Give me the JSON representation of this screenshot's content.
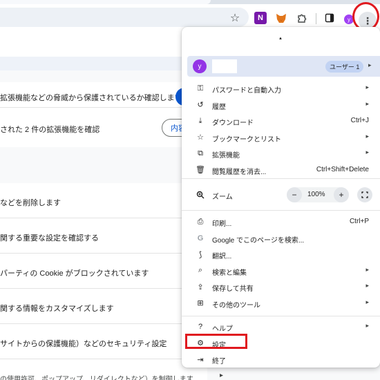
{
  "toolbar": {
    "onenote_label": "N",
    "avatar_letter": "y",
    "kebab_label": "⋮"
  },
  "page": {
    "card1_text1": "拡張機能などの脅威から保護されているか確認します",
    "card1_text2": "された 2 件の拡張機能を確認",
    "review_button": "内容",
    "rows": [
      "などを削除します",
      "関する重要な設定を確認する",
      "パーティの Cookie がブロックされています",
      "関する情報をカスタマイズします",
      "サイトからの保護機能）などのセキュリティ設定"
    ],
    "bottom_text": "の使用許可、ポップアップ、リダイレクトなど）を制御します"
  },
  "menu": {
    "profile": {
      "avatar_letter": "y",
      "badge": "ユーザー 1"
    },
    "items_group1": [
      {
        "icon": "key-icon",
        "glyph": "⚿",
        "label": "パスワードと自動入力",
        "shortcut": "",
        "submenu": true
      },
      {
        "icon": "history-icon",
        "glyph": "↺",
        "label": "履歴",
        "shortcut": "",
        "submenu": true
      },
      {
        "icon": "download-icon",
        "glyph": "⤓",
        "label": "ダウンロード",
        "shortcut": "Ctrl+J",
        "submenu": false
      },
      {
        "icon": "star-icon",
        "glyph": "☆",
        "label": "ブックマークとリスト",
        "shortcut": "",
        "submenu": true
      },
      {
        "icon": "puzzle-icon",
        "glyph": "⧉",
        "label": "拡張機能",
        "shortcut": "",
        "submenu": true
      },
      {
        "icon": "trash-icon",
        "glyph": "🗑",
        "label": "閲覧履歴を消去...",
        "shortcut": "Ctrl+Shift+Delete",
        "submenu": false
      }
    ],
    "zoom": {
      "label": "ズーム",
      "minus": "−",
      "value": "100%",
      "plus": "+"
    },
    "items_group2": [
      {
        "icon": "print-icon",
        "glyph": "⎙",
        "label": "印刷...",
        "shortcut": "Ctrl+P",
        "submenu": false
      },
      {
        "icon": "google-icon",
        "glyph": "G",
        "label": "Google でこのページを検索...",
        "shortcut": "",
        "submenu": false
      },
      {
        "icon": "translate-icon",
        "glyph": "⟆",
        "label": "翻訳...",
        "shortcut": "",
        "submenu": false
      },
      {
        "icon": "search-edit-icon",
        "glyph": "⌕",
        "label": "検索と編集",
        "shortcut": "",
        "submenu": true
      },
      {
        "icon": "save-share-icon",
        "glyph": "⇪",
        "label": "保存して共有",
        "shortcut": "",
        "submenu": true
      },
      {
        "icon": "toolbox-icon",
        "glyph": "⊞",
        "label": "その他のツール",
        "shortcut": "",
        "submenu": true
      }
    ],
    "items_group3": [
      {
        "icon": "help-icon",
        "glyph": "?",
        "label": "ヘルプ",
        "shortcut": "",
        "submenu": true
      },
      {
        "icon": "gear-icon",
        "glyph": "⚙",
        "label": "設定",
        "shortcut": "",
        "submenu": false
      },
      {
        "icon": "exit-icon",
        "glyph": "⇥",
        "label": "終了",
        "shortcut": "",
        "submenu": false
      }
    ]
  },
  "colors": {
    "annotation_red": "#e0191f",
    "profile_highlight": "#dfe6f5",
    "accent_blue": "#0b57d0"
  }
}
